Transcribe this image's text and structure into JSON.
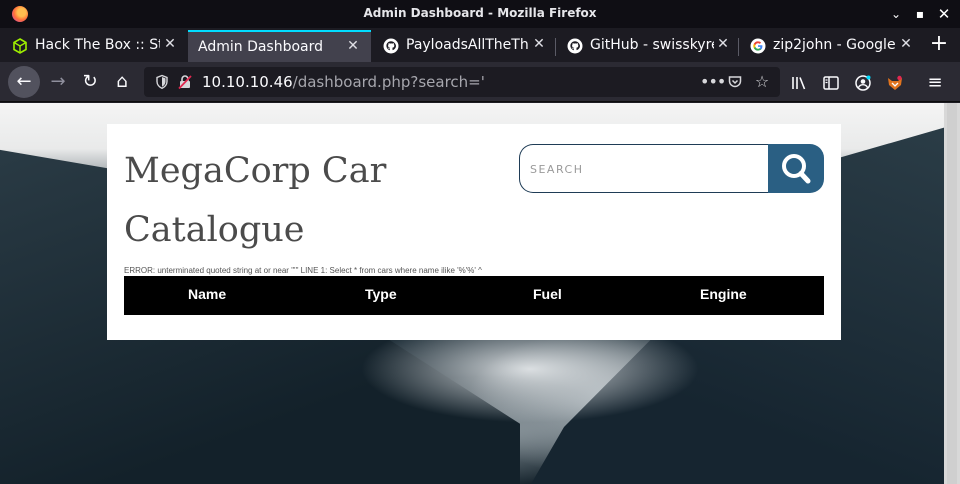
{
  "window": {
    "title": "Admin Dashboard - Mozilla Firefox"
  },
  "tabs": [
    {
      "label": "Hack The Box :: Sta",
      "icon": "htb-cube-icon",
      "active": false
    },
    {
      "label": "Admin Dashboard",
      "icon": "",
      "active": true
    },
    {
      "label": "PayloadsAllTheThi",
      "icon": "github-icon",
      "active": false
    },
    {
      "label": "GitHub - swisskyre",
      "icon": "github-icon",
      "active": false
    },
    {
      "label": "zip2john - Google",
      "icon": "google-icon",
      "active": false
    }
  ],
  "address": {
    "host": "10.10.10.46",
    "path": "/dashboard.php?search='"
  },
  "page": {
    "brand_line1": "MegaCorp Car",
    "brand_line2": "Catalogue",
    "search_placeholder": "SEARCH",
    "error": "ERROR: unterminated quoted string at or near \"'\" LINE 1: Select * from cars where name ilike '%'%' ^",
    "columns": [
      "Name",
      "Type",
      "Fuel",
      "Engine"
    ]
  },
  "colors": {
    "search_button": "#2a5f83",
    "active_tab_indicator": "#00ddff",
    "table_header": "#000000"
  }
}
